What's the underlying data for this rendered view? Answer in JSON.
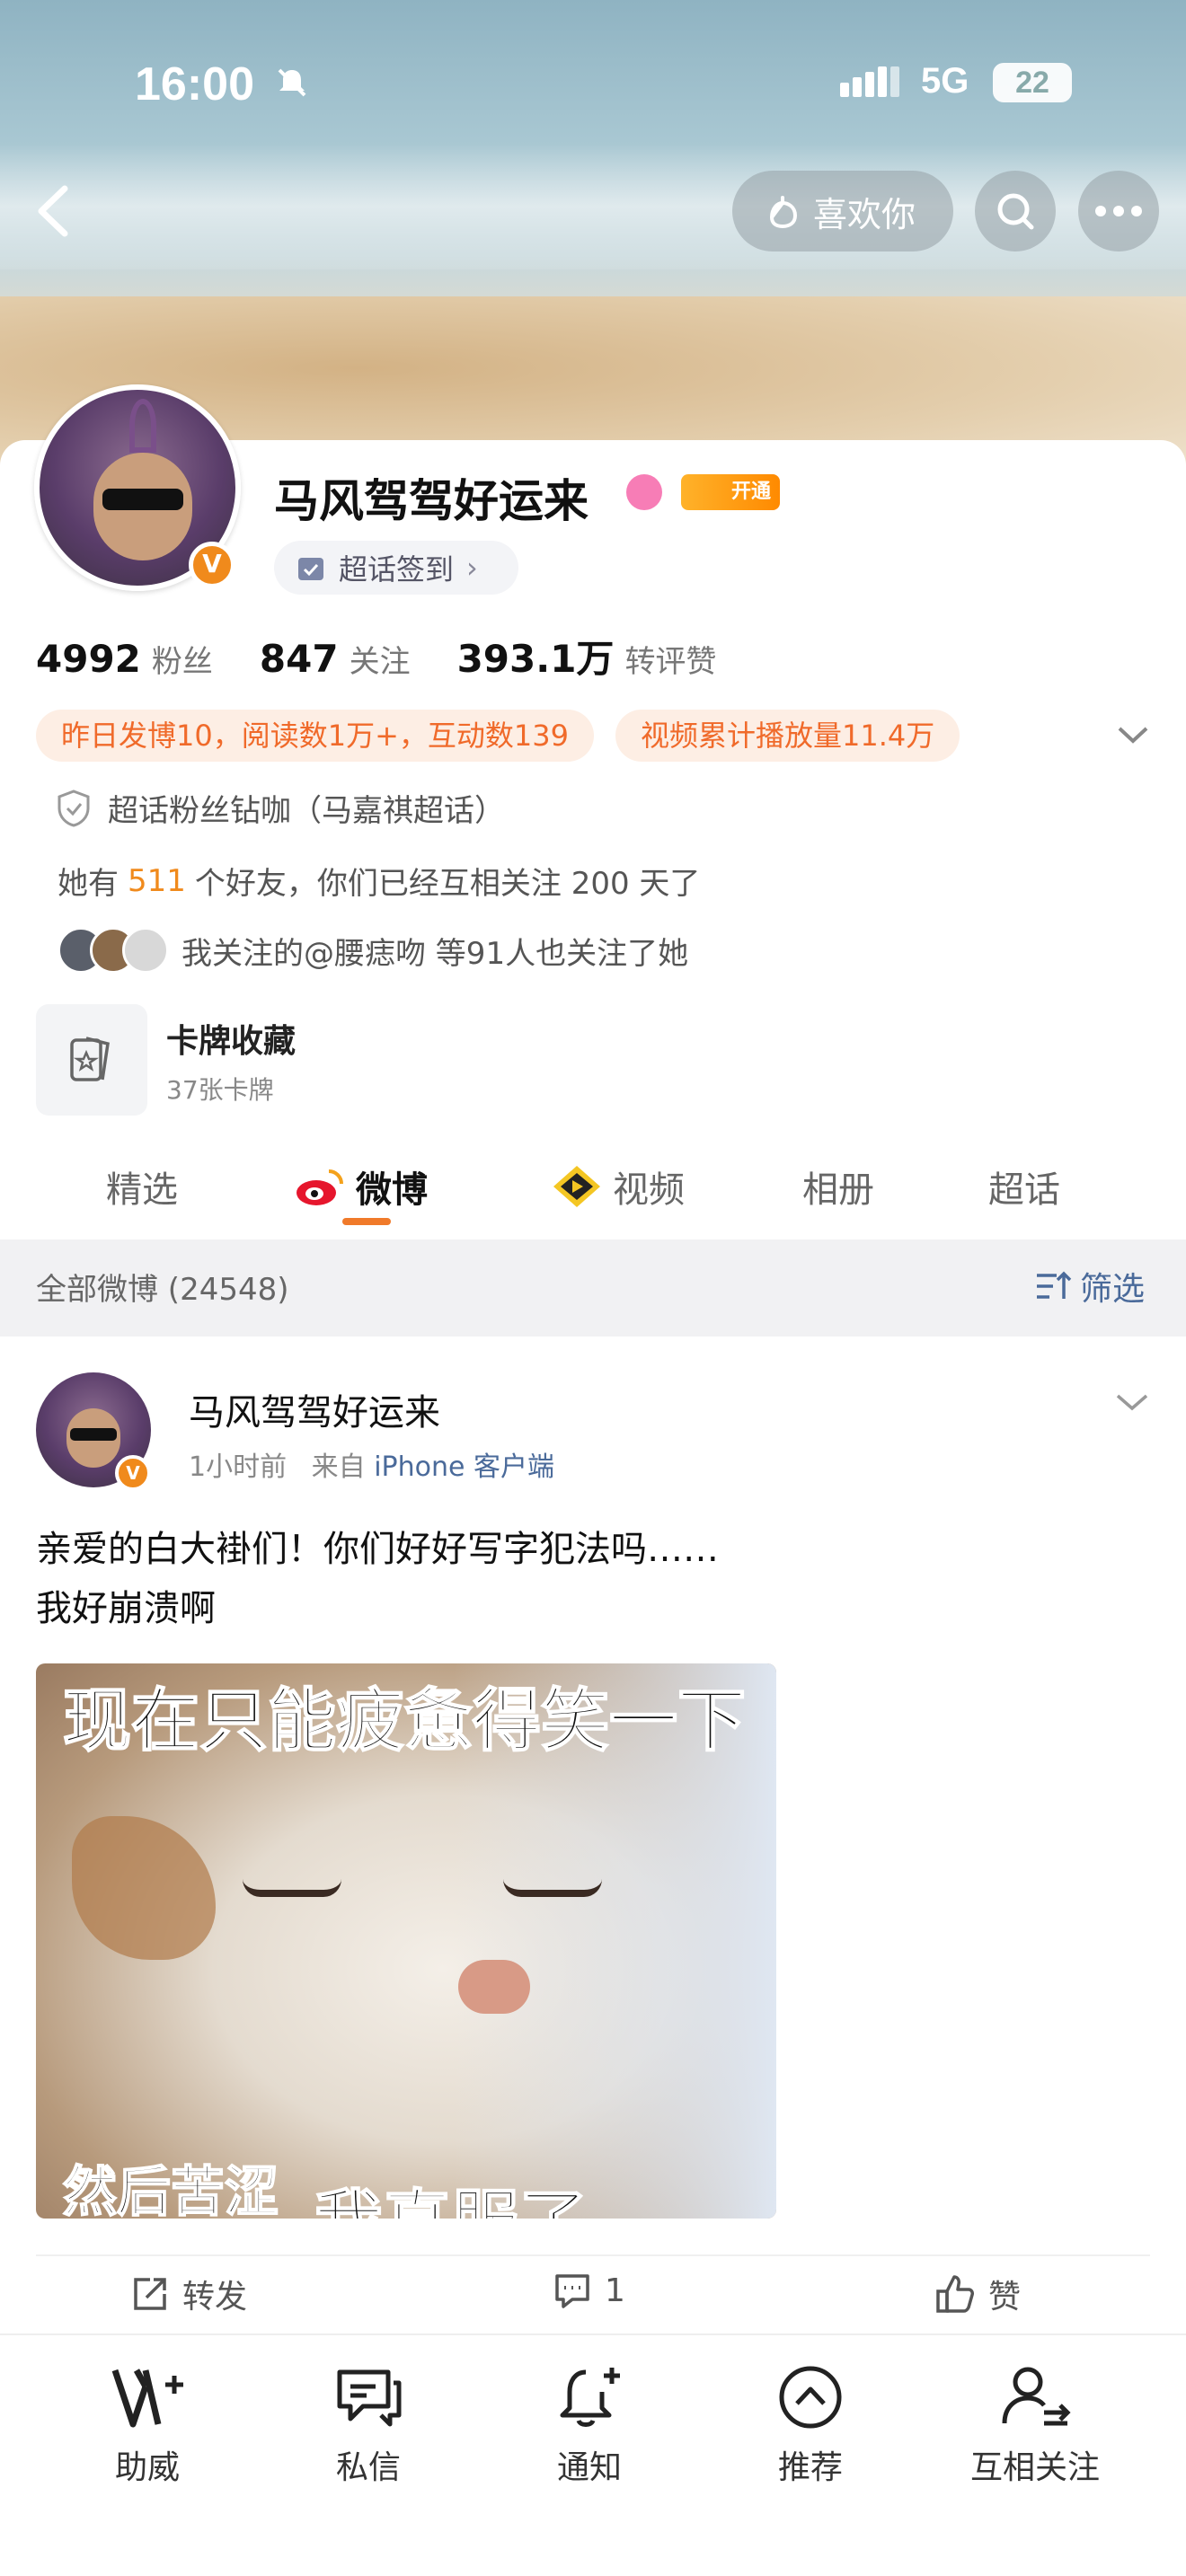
{
  "status_bar": {
    "time": "16:00",
    "network": "5G",
    "battery": "22"
  },
  "header": {
    "like_label": "喜欢你"
  },
  "profile": {
    "name": "马风驾驾好运来",
    "vip_label": "开通",
    "checkin_label": "超话签到",
    "stats": [
      {
        "value": "4992",
        "label": "粉丝"
      },
      {
        "value": "847",
        "label": "关注"
      },
      {
        "value": "393.1万",
        "label": "转评赞"
      }
    ],
    "tags": [
      "昨日发博10，阅读数1万+，互动数139",
      "视频累计播放量11.4万"
    ],
    "supertopic_badge": "超话粉丝钻咖（马嘉祺超话）",
    "friends_prefix": "她有",
    "friends_count": "511",
    "friends_suffix": "个好友，你们已经互相关注 200 天了",
    "mutual_follow_text": "我关注的@腰痣吻 等91人也关注了她",
    "cards_title": "卡牌收藏",
    "cards_sub": "37张卡牌"
  },
  "tabs": [
    {
      "label": "精选"
    },
    {
      "label": "微博"
    },
    {
      "label": "视频"
    },
    {
      "label": "相册"
    },
    {
      "label": "超话"
    }
  ],
  "filter_bar": {
    "all_label": "全部微博 (24548)",
    "filter_label": "筛选"
  },
  "post": {
    "author": "马风驾驾好运来",
    "time": "1小时前",
    "source_prefix": "来自",
    "source": "iPhone 客户端",
    "text_line1": "亲爱的白大褂们！你们好好写字犯法吗……",
    "text_line2": "我好崩溃啊",
    "image_caption_top": "现在只能疲惫得笑一下",
    "image_caption_bottom_left": "然后苦涩",
    "image_caption_bottom_right": "我真服了",
    "repost_label": "转发",
    "comment_count": "1",
    "like_label": "赞"
  },
  "bottom_bar": [
    {
      "label": "助威",
      "icon": "v-plus-icon"
    },
    {
      "label": "私信",
      "icon": "message-icon"
    },
    {
      "label": "通知",
      "icon": "bell-plus-icon"
    },
    {
      "label": "推荐",
      "icon": "recommend-icon"
    },
    {
      "label": "互相关注",
      "icon": "mutual-follow-icon"
    }
  ],
  "colors": {
    "accent": "#f07a2a",
    "link": "#4a6a9a",
    "tag_bg": "#fdeee4"
  }
}
